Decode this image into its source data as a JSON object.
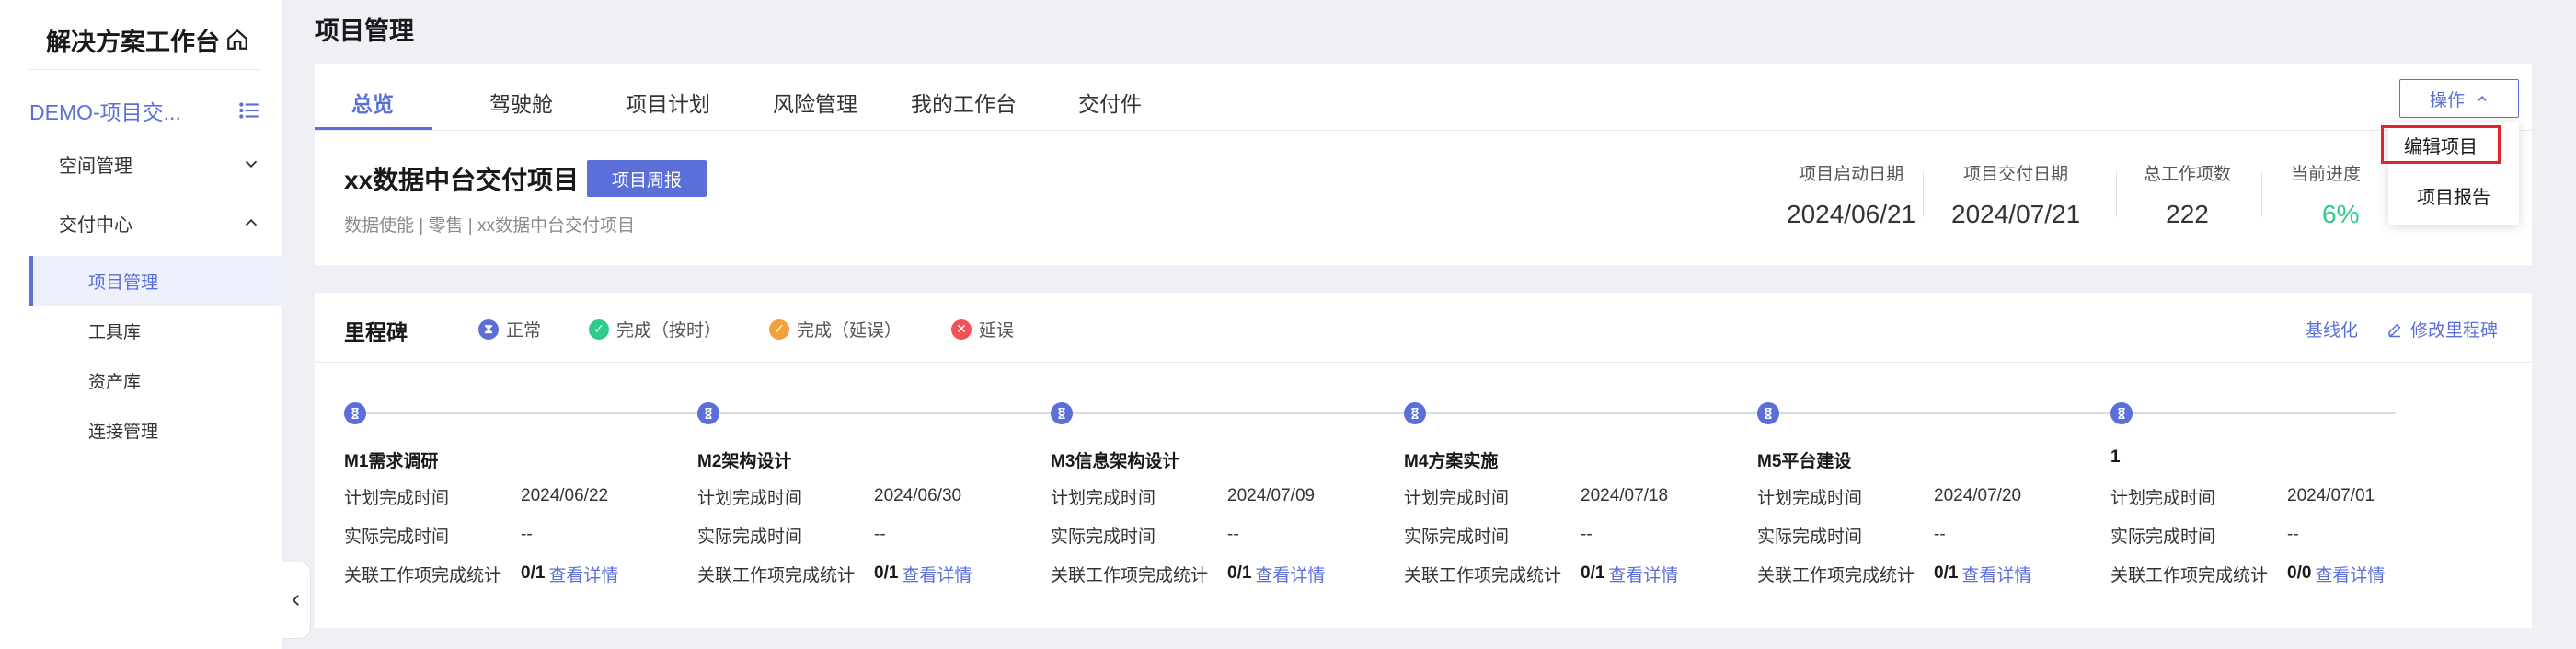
{
  "sidebar": {
    "title": "解决方案工作台",
    "project": "DEMO-项目交...",
    "groups": [
      {
        "label": "空间管理"
      },
      {
        "label": "交付中心"
      }
    ],
    "items": [
      {
        "label": "项目管理"
      },
      {
        "label": "工具库"
      },
      {
        "label": "资产库"
      },
      {
        "label": "连接管理"
      }
    ]
  },
  "page_title": "项目管理",
  "tabs": [
    "总览",
    "驾驶舱",
    "项目计划",
    "风险管理",
    "我的工作台",
    "交付件"
  ],
  "ops_button": "操作",
  "dropdown": [
    "编辑项目",
    "项目报告"
  ],
  "project": {
    "name": "xx数据中台交付项目",
    "report_button": "项目周报",
    "sub": "数据使能  |  零售  |  xx数据中台交付项目"
  },
  "stats": [
    {
      "label": "项目启动日期",
      "value": "2024/06/21"
    },
    {
      "label": "项目交付日期",
      "value": "2024/07/21"
    },
    {
      "label": "总工作项数",
      "value": "222"
    },
    {
      "label": "当前进度",
      "value": "6%"
    }
  ],
  "milestones_card": {
    "title": "里程碑",
    "legend": [
      {
        "label": "正常",
        "color": "#5b6fd9"
      },
      {
        "label": "完成（按时）",
        "color": "#2ecc8a"
      },
      {
        "label": "完成（延误）",
        "color": "#f5a03c"
      },
      {
        "label": "延误",
        "color": "#f0525a"
      }
    ],
    "baseline_link": "基线化",
    "edit_link": "修改里程碑",
    "field_labels": {
      "plan": "计划完成时间",
      "actual": "实际完成时间",
      "stats": "关联工作项完成统计",
      "detail": "查看详情"
    },
    "items": [
      {
        "name": "M1需求调研",
        "plan": "2024/06/22",
        "actual": "--",
        "count": "0/1"
      },
      {
        "name": "M2架构设计",
        "plan": "2024/06/30",
        "actual": "--",
        "count": "0/1"
      },
      {
        "name": "M3信息架构设计",
        "plan": "2024/07/09",
        "actual": "--",
        "count": "0/1"
      },
      {
        "name": "M4方案实施",
        "plan": "2024/07/18",
        "actual": "--",
        "count": "0/1"
      },
      {
        "name": "M5平台建设",
        "plan": "2024/07/20",
        "actual": "--",
        "count": "0/1"
      },
      {
        "name": "1",
        "plan": "2024/07/01",
        "actual": "--",
        "count": "0/0"
      }
    ]
  },
  "colors": {
    "accent": "#5b6fd9",
    "progress_green": "#2ecc8a",
    "highlight_red": "#e0252f"
  }
}
